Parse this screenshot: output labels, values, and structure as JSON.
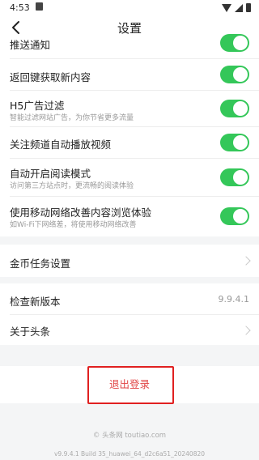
{
  "status": {
    "time": "4:53"
  },
  "header": {
    "title": "设置"
  },
  "toggles": [
    {
      "label": "推送通知",
      "sub": ""
    },
    {
      "label": "返回键获取新内容",
      "sub": ""
    },
    {
      "label": "H5广告过滤",
      "sub": "智能过滤网站广告，为你节省更多流量"
    },
    {
      "label": "关注频道自动播放视频",
      "sub": ""
    },
    {
      "label": "自动开启阅读模式",
      "sub": "访问第三方站点时，更流畅的阅读体验"
    },
    {
      "label": "使用移动网络改善内容浏览体验",
      "sub": "如Wi-Fi下网络差，将使用移动网络改善"
    }
  ],
  "coin": {
    "label": "金币任务设置"
  },
  "version": {
    "label": "检查新版本",
    "value": "9.9.4.1"
  },
  "about": {
    "label": "关于头条"
  },
  "logout": {
    "label": "退出登录"
  },
  "footer": {
    "copyright": "© 头条网 toutiao.com",
    "build": "v9.9.4.1 Build 35_huawei_64_d2c6a51_20240820"
  },
  "colors": {
    "toggle_on": "#34c759",
    "logout_text": "#e14545",
    "highlight_border": "#e02020"
  }
}
